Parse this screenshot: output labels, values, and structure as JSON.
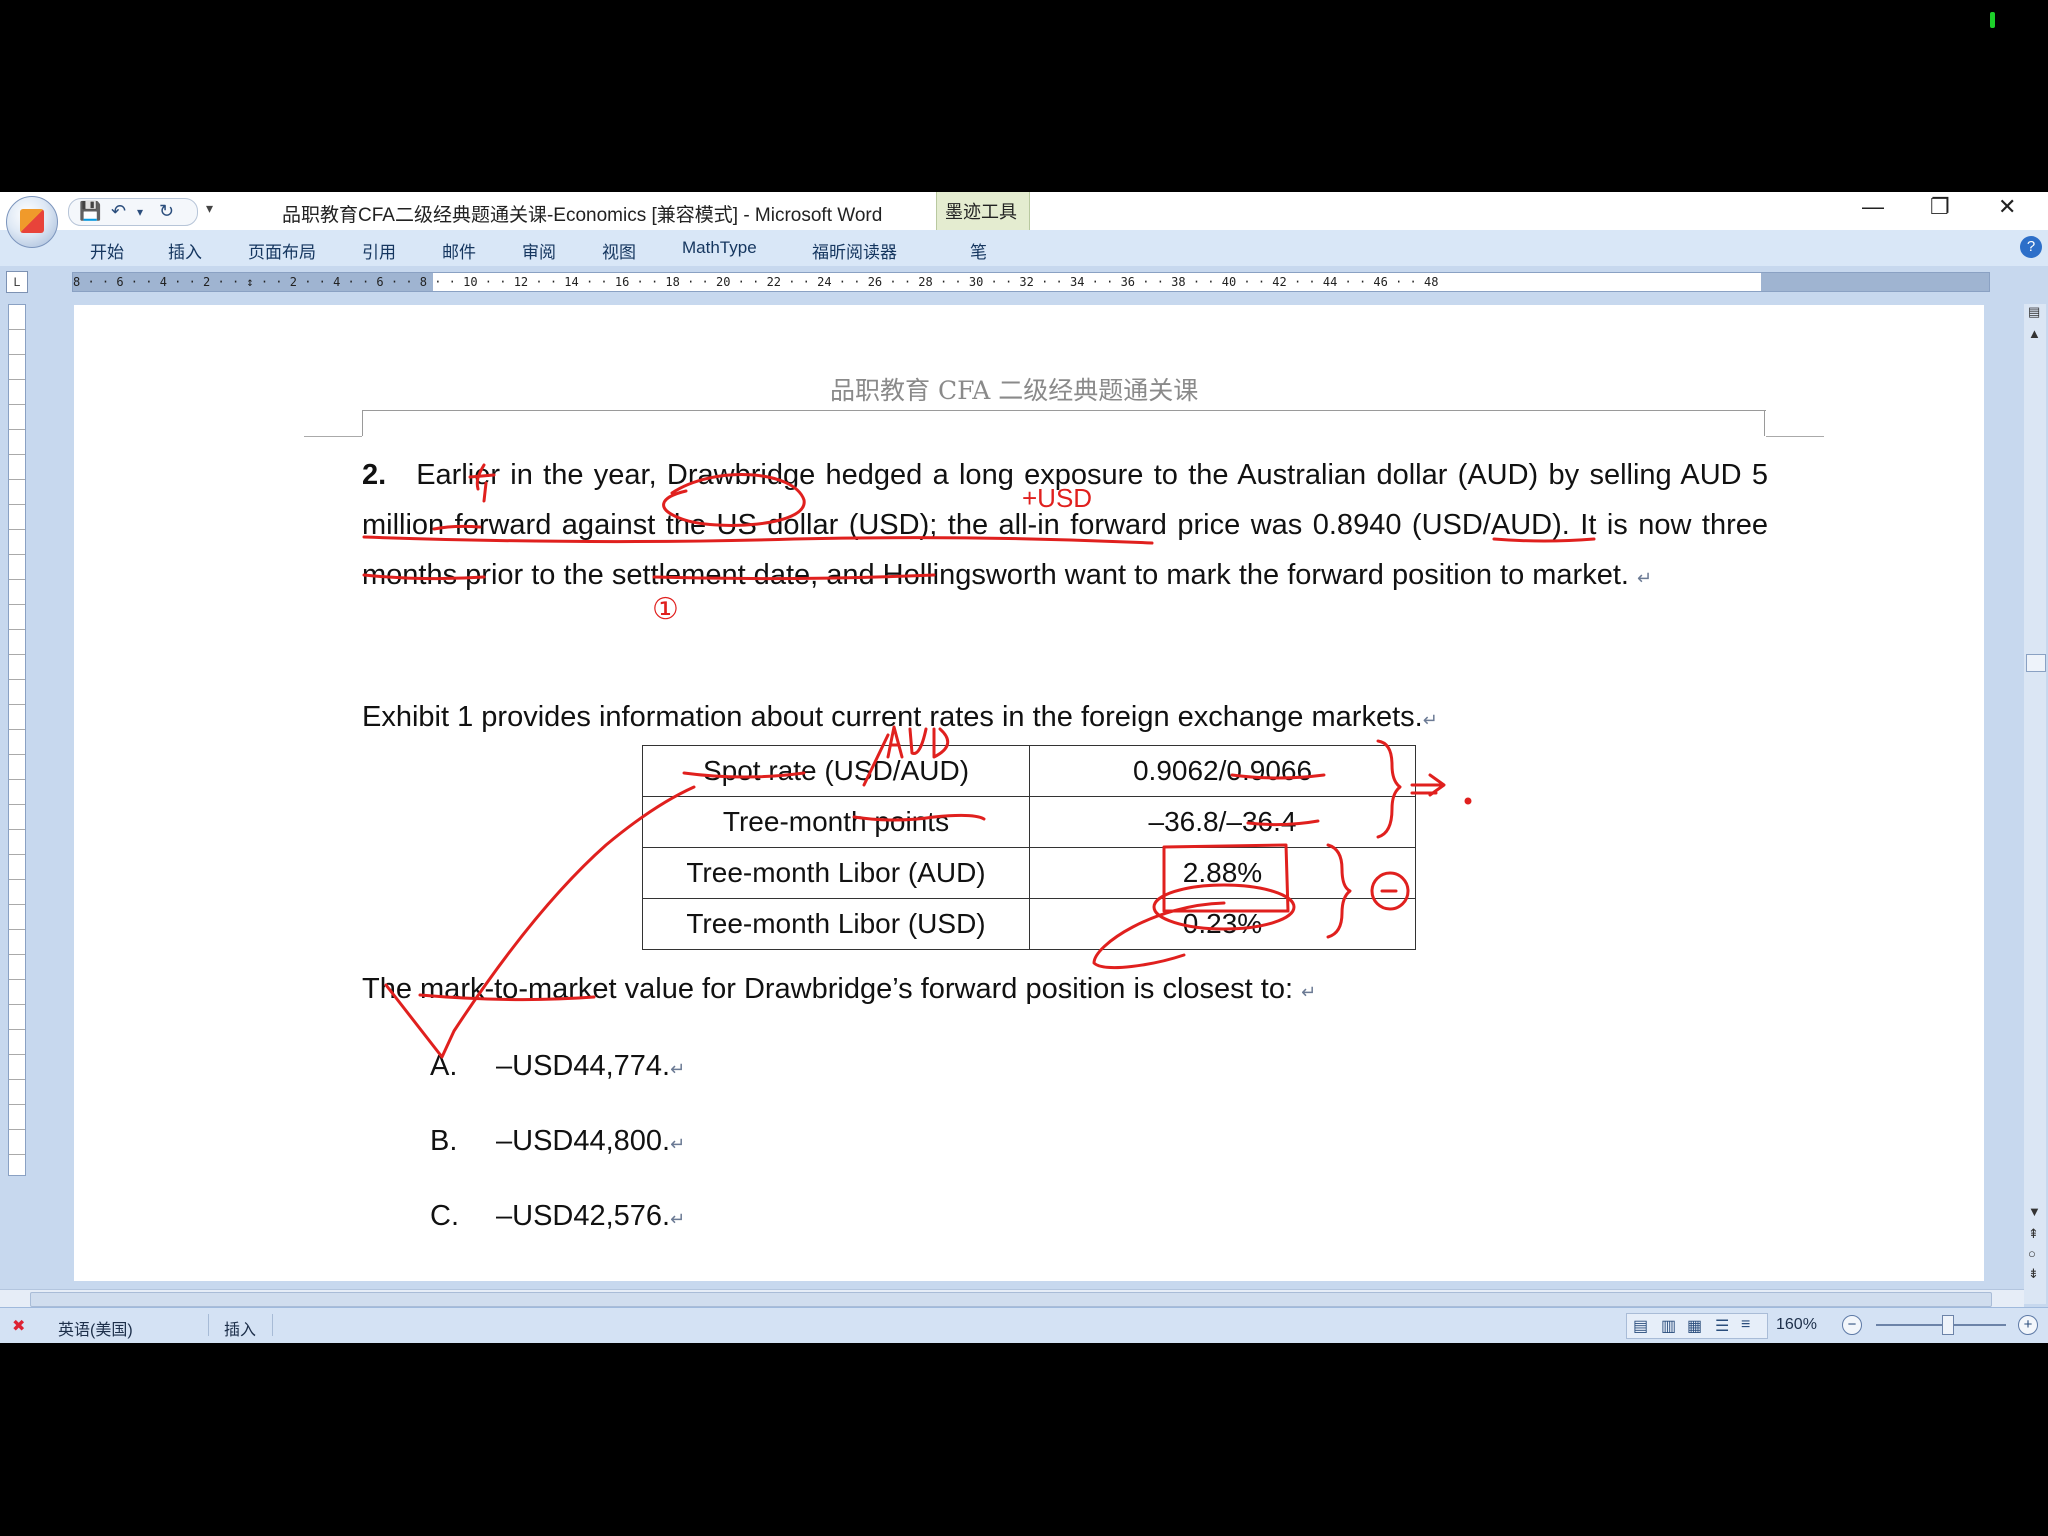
{
  "window": {
    "title": "品职教育CFA二级经典题通关课-Economics [兼容模式] - Microsoft Word",
    "contextual_tab": "墨迹工具",
    "controls": {
      "minimize": "—",
      "restore": "❐",
      "close": "✕"
    }
  },
  "quick_access": {
    "save": "💾",
    "undo": "↶",
    "undo_menu": "▾",
    "redo": "↻",
    "customize": "▾"
  },
  "ribbon_tabs": [
    "开始",
    "插入",
    "页面布局",
    "引用",
    "邮件",
    "审阅",
    "视图",
    "MathType",
    "福昕阅读器",
    "笔"
  ],
  "ruler": {
    "corner": "L",
    "numbers": "8 · · 6 · · 4 · · 2 · · ↕ · · 2 · · 4 · · 6 · · 8 · · 10 · · 12 · · 14 · · 16 · · 18 · · 20 · · 22 · · 24 · · 26 · · 28 · · 30 · · 32 · · 34 · · 36 · · 38 · · 40 · · 42 · · 44 · · 46 · · 48"
  },
  "document": {
    "header": "品职教育 CFA 二级经典题通关课",
    "question_number": "2.",
    "question_text": "Earlier in the year, Drawbridge hedged a long exposure to the Australian dollar (AUD) by selling AUD 5 million forward against the US dollar (USD); the all-in forward price was 0.8940 (USD/AUD). It is now three months prior to the settlement date, and Hollingsworth want to mark the forward position to market.",
    "exhibit_intro": "Exhibit 1 provides information about current rates in the foreign exchange markets.",
    "table": [
      {
        "label": "Spot rate (USD/AUD)",
        "value": "0.9062/0.9066"
      },
      {
        "label": "Tree-month points",
        "value": "–36.8/–36.4"
      },
      {
        "label": "Tree-month Libor (AUD)",
        "value": "2.88%"
      },
      {
        "label": "Tree-month Libor (USD)",
        "value": "0.23%"
      }
    ],
    "stem": "The mark-to-market value for Drawbridge’s forward position is closest to:",
    "options": [
      {
        "letter": "A.",
        "text": "–USD44,774."
      },
      {
        "letter": "B.",
        "text": "–USD44,800."
      },
      {
        "letter": "C.",
        "text": "–USD42,576."
      }
    ],
    "paragraph_mark": "↵"
  },
  "annotations": {
    "color": "#e0201e",
    "labels": [
      "+USD",
      "①",
      "①"
    ]
  },
  "status_bar": {
    "language": "英语(美国)",
    "mode": "插入",
    "zoom": "160%",
    "zoom_out": "−",
    "zoom_in": "+"
  }
}
